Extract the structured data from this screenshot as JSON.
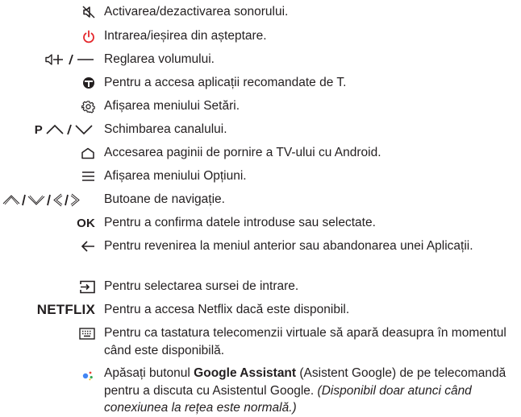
{
  "items": [
    {
      "icon": "mute-icon",
      "text": "Activarea/dezactivarea sonorului."
    },
    {
      "icon": "power-icon",
      "text": "Intrarea/ieșirea din așteptare.",
      "color": "#e4262b"
    },
    {
      "icon": "volume-plus-minus-icon",
      "text": "Reglarea volumului."
    },
    {
      "icon": "recommended-apps-icon",
      "text": "Pentru a accesa aplicații recomandate de T."
    },
    {
      "icon": "settings-gear-icon",
      "text": "Afișarea meniului Setări."
    },
    {
      "icon": "channel-up-down-icon",
      "label": "P",
      "text": "Schimbarea canalului."
    },
    {
      "icon": "home-icon",
      "text": "Accesarea paginii de pornire a TV-ului cu Android."
    },
    {
      "icon": "options-menu-icon",
      "text": "Afișarea meniului Opțiuni."
    },
    {
      "icon": "navigation-arrows-icon",
      "text": "Butoane de navigație."
    },
    {
      "icon": "ok-label",
      "label": "OK",
      "text": "Pentru a confirma datele introduse sau selectate."
    },
    {
      "icon": "back-arrow-icon",
      "text": "Pentru revenirea la meniul anterior sau abandonarea unei Aplicații."
    },
    {
      "icon": "input-source-icon",
      "text": "Pentru selectarea sursei de intrare."
    },
    {
      "icon": "netflix-label",
      "label": "NETFLIX",
      "text": "Pentru a accesa Netflix dacă este disponibil."
    },
    {
      "icon": "virtual-keyboard-icon",
      "text": "Pentru ca tastatura telecomenzii virtuale să apară deasupra în momentul când este disponibilă."
    },
    {
      "icon": "google-assistant-icon",
      "text_pre": "Apăsați butonul ",
      "text_bold": "Google Assistant",
      "text_mid": " (Asistent Google) de pe telecomandă pentru a discuta cu Asistentul Google. ",
      "text_italic": "(Disponibil doar atunci când conexiunea la rețea este normală.)"
    }
  ],
  "colors": {
    "text": "#231f20",
    "power": "#e4262b",
    "ga_blue": "#4285f4",
    "ga_red": "#ea4335",
    "ga_yellow": "#fbbc05",
    "ga_green": "#34a853"
  }
}
